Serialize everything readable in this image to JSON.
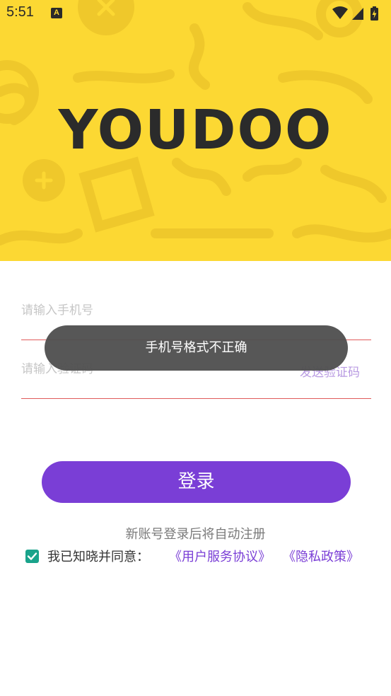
{
  "status_bar": {
    "time": "5:51",
    "notification_icon": "a-letter-icon",
    "wifi_icon": "wifi-icon",
    "signal_icon": "signal-icon",
    "battery_icon": "battery-charging-icon"
  },
  "header": {
    "logo_text": "YOUDOO",
    "background_color": "#fcd833"
  },
  "form": {
    "phone_placeholder": "请输入手机号",
    "phone_value": "",
    "code_placeholder": "请输入验证码",
    "code_value": "",
    "send_code_label": "发送验证码"
  },
  "toast": {
    "message": "手机号格式不正确"
  },
  "login": {
    "button_label": "登录",
    "accent_color": "#7a3ed6",
    "auto_register_note": "新账号登录后将自动注册"
  },
  "agreement": {
    "checked": true,
    "text": "我已知晓并同意：",
    "terms_link": "《用户服务协议》",
    "privacy_link": "《隐私政策》"
  }
}
